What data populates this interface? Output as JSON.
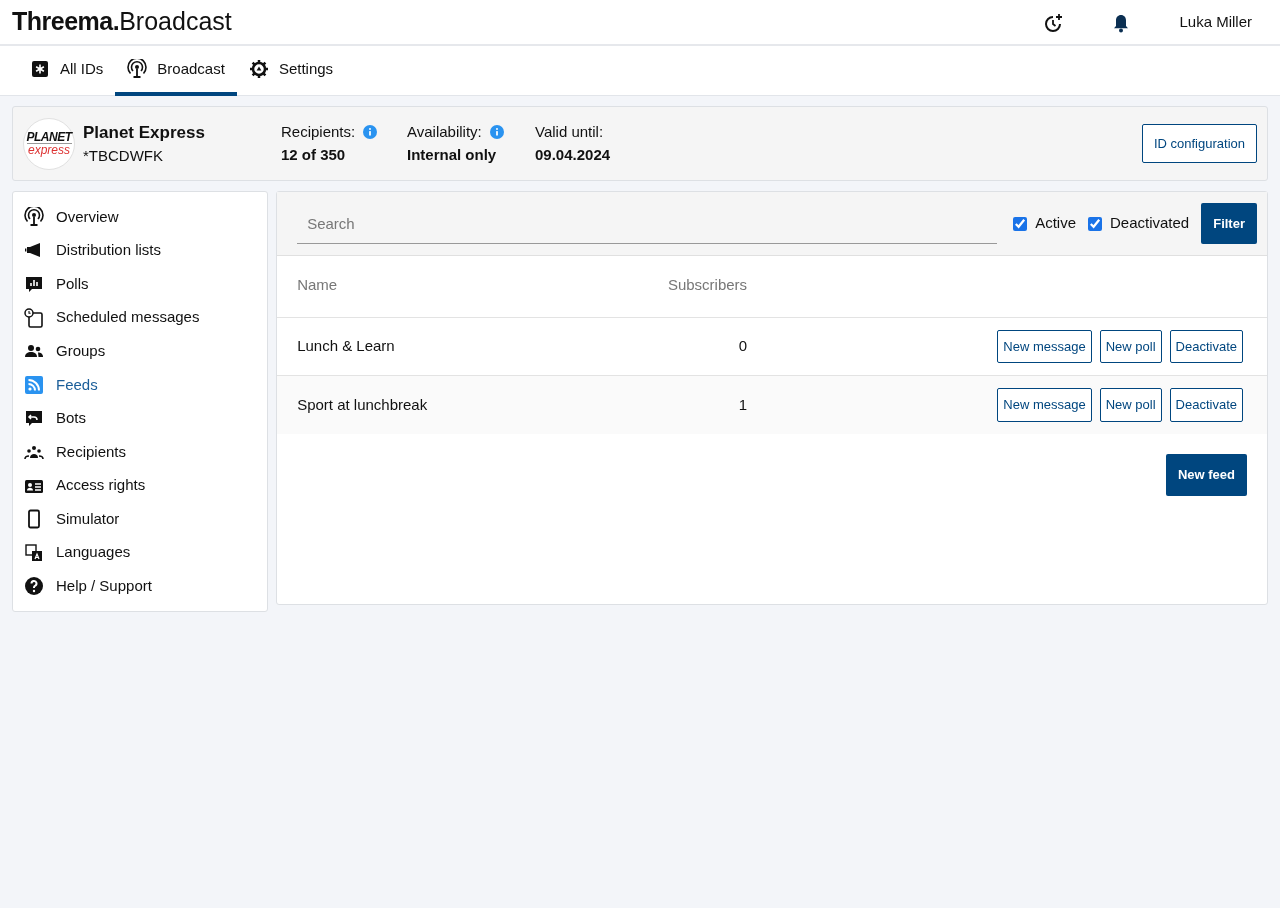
{
  "header": {
    "brand_bold": "Threema.",
    "brand_light": "Broadcast",
    "user": "Luka Miller"
  },
  "tabs": [
    {
      "label": "All IDs",
      "selected": false
    },
    {
      "label": "Broadcast",
      "selected": true
    },
    {
      "label": "Settings",
      "selected": false
    }
  ],
  "profile": {
    "logo_top": "PLANET",
    "logo_bottom": "express",
    "name": "Planet Express",
    "id": "*TBCDWFK",
    "stats": [
      {
        "label": "Recipients:",
        "value": "12 of 350",
        "info": true
      },
      {
        "label": "Availability:",
        "value": "Internal only",
        "info": true
      },
      {
        "label": "Valid until:",
        "value": "09.04.2024",
        "info": false
      }
    ],
    "button": "ID configuration"
  },
  "sidebar": {
    "items": [
      {
        "label": "Overview",
        "selected": false
      },
      {
        "label": "Distribution lists",
        "selected": false
      },
      {
        "label": "Polls",
        "selected": false
      },
      {
        "label": "Scheduled messages",
        "selected": false
      },
      {
        "label": "Groups",
        "selected": false
      },
      {
        "label": "Feeds",
        "selected": true
      },
      {
        "label": "Bots",
        "selected": false
      },
      {
        "label": "Recipients",
        "selected": false
      },
      {
        "label": "Access rights",
        "selected": false
      },
      {
        "label": "Simulator",
        "selected": false
      },
      {
        "label": "Languages",
        "selected": false
      },
      {
        "label": "Help / Support",
        "selected": false
      }
    ]
  },
  "filter": {
    "search": {
      "placeholder": "Search"
    },
    "checkboxes": [
      {
        "label": "Active",
        "checked": true
      },
      {
        "label": "Deactivated",
        "checked": true
      }
    ],
    "button": "Filter"
  },
  "table": {
    "columns": [
      "Name",
      "Subscribers"
    ],
    "rows": [
      {
        "name": "Lunch & Learn",
        "subscribers": "0",
        "actions": [
          "New message",
          "New poll",
          "Deactivate"
        ]
      },
      {
        "name": "Sport at lunchbreak",
        "subscribers": "1",
        "actions": [
          "New message",
          "New poll",
          "Deactivate"
        ]
      }
    ]
  },
  "new_button": "New feed"
}
